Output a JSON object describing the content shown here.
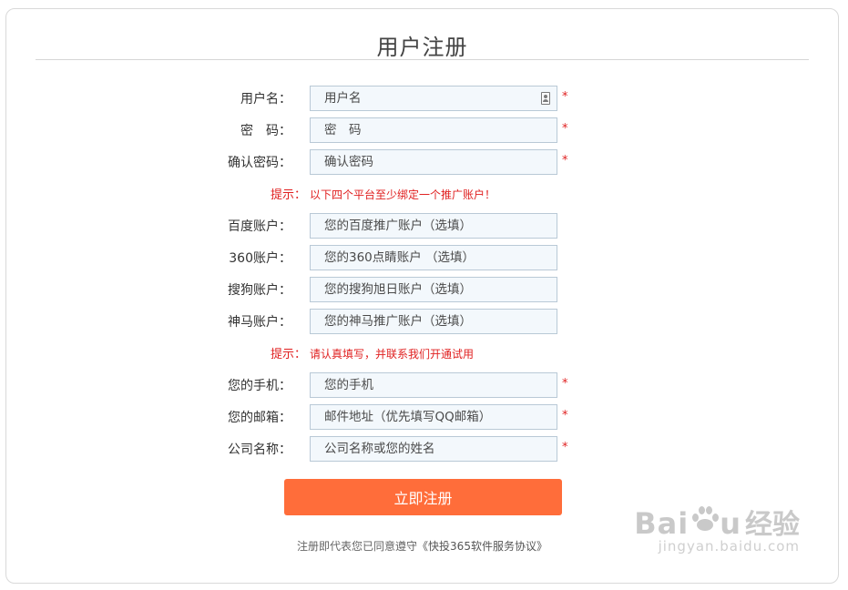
{
  "page": {
    "title": "用户注册"
  },
  "fields": [
    {
      "label": "用户名：",
      "placeholder": "用户名",
      "required": true
    },
    {
      "label": "密　码：",
      "placeholder": "密　码",
      "required": true
    },
    {
      "label": "确认密码：",
      "placeholder": "确认密码",
      "required": true
    },
    {
      "label": "百度账户：",
      "placeholder": "您的百度推广账户（选填）",
      "required": false
    },
    {
      "label": "360账户：",
      "placeholder": "您的360点睛账户 （选填）",
      "required": false
    },
    {
      "label": "搜狗账户：",
      "placeholder": "您的搜狗旭日账户（选填）",
      "required": false
    },
    {
      "label": "神马账户：",
      "placeholder": "您的神马推广账户（选填）",
      "required": false
    },
    {
      "label": "您的手机：",
      "placeholder": "您的手机",
      "required": true
    },
    {
      "label": "您的邮箱：",
      "placeholder": "邮件地址（优先填写QQ邮箱）",
      "required": true
    },
    {
      "label": "公司名称：",
      "placeholder": "公司名称或您的姓名",
      "required": true
    }
  ],
  "required_mark": "*",
  "hints": [
    {
      "label": "提示：",
      "text": "以下四个平台至少绑定一个推广账户！"
    },
    {
      "label": "提示：",
      "text": "请认真填写，并联系我们开通试用"
    }
  ],
  "submit": {
    "label": "立即注册"
  },
  "agreement": {
    "prefix": "注册即代表您已同意遵守",
    "link": "《快投365软件服务协议》"
  },
  "watermark": {
    "logo": "Bai",
    "logo_suffix": "u",
    "cn": "经验",
    "url": "jingyan.baidu.com"
  },
  "colors": {
    "accent": "#ff6d3a",
    "required": "#e02020",
    "input_bg": "#f3f8fc",
    "input_border": "#b9c9d6"
  }
}
